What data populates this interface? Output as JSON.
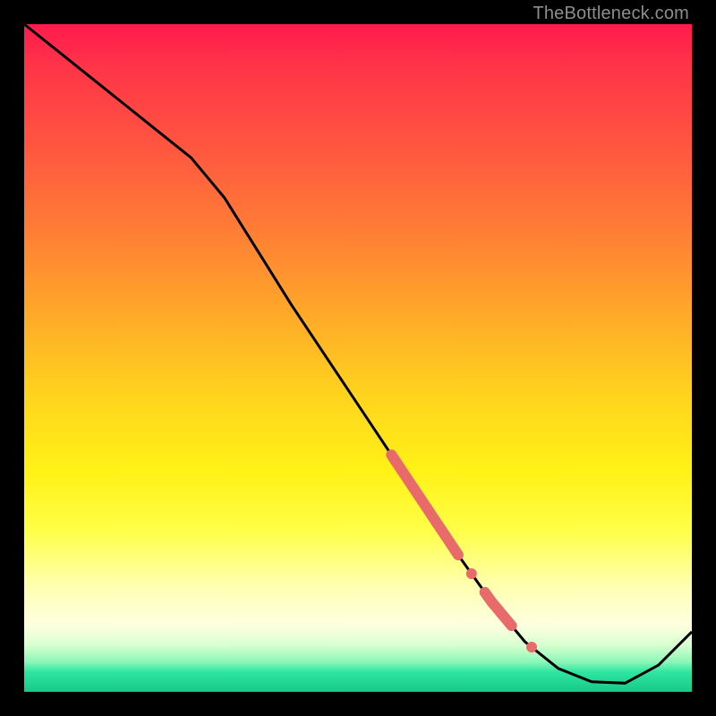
{
  "watermark": "TheBottleneck.com",
  "colors": {
    "frame": "#000000",
    "line": "#000000",
    "marker": "#e86a6a"
  },
  "chart_data": {
    "type": "line",
    "title": "",
    "xlabel": "",
    "ylabel": "",
    "xlim": [
      0,
      100
    ],
    "ylim": [
      0,
      100
    ],
    "grid": false,
    "legend": false,
    "series": [
      {
        "name": "bottleneck-curve",
        "x": [
          0,
          5,
          10,
          15,
          20,
          25,
          30,
          35,
          40,
          45,
          50,
          55,
          60,
          65,
          70,
          75,
          80,
          85,
          90,
          95,
          100
        ],
        "y": [
          100,
          96,
          92,
          88,
          84,
          80,
          74,
          66,
          58,
          50.5,
          43,
          35.5,
          28,
          20.5,
          13.5,
          7.5,
          3.5,
          1.5,
          1.3,
          4,
          9
        ]
      }
    ],
    "markers": [
      {
        "name": "highlight-segment-1",
        "x_start": 55,
        "x_end": 65,
        "thick": true
      },
      {
        "name": "highlight-dot-1",
        "x": 67
      },
      {
        "name": "highlight-segment-2",
        "x_start": 69,
        "x_end": 73,
        "thick": true
      },
      {
        "name": "highlight-dot-2",
        "x": 76
      }
    ]
  }
}
